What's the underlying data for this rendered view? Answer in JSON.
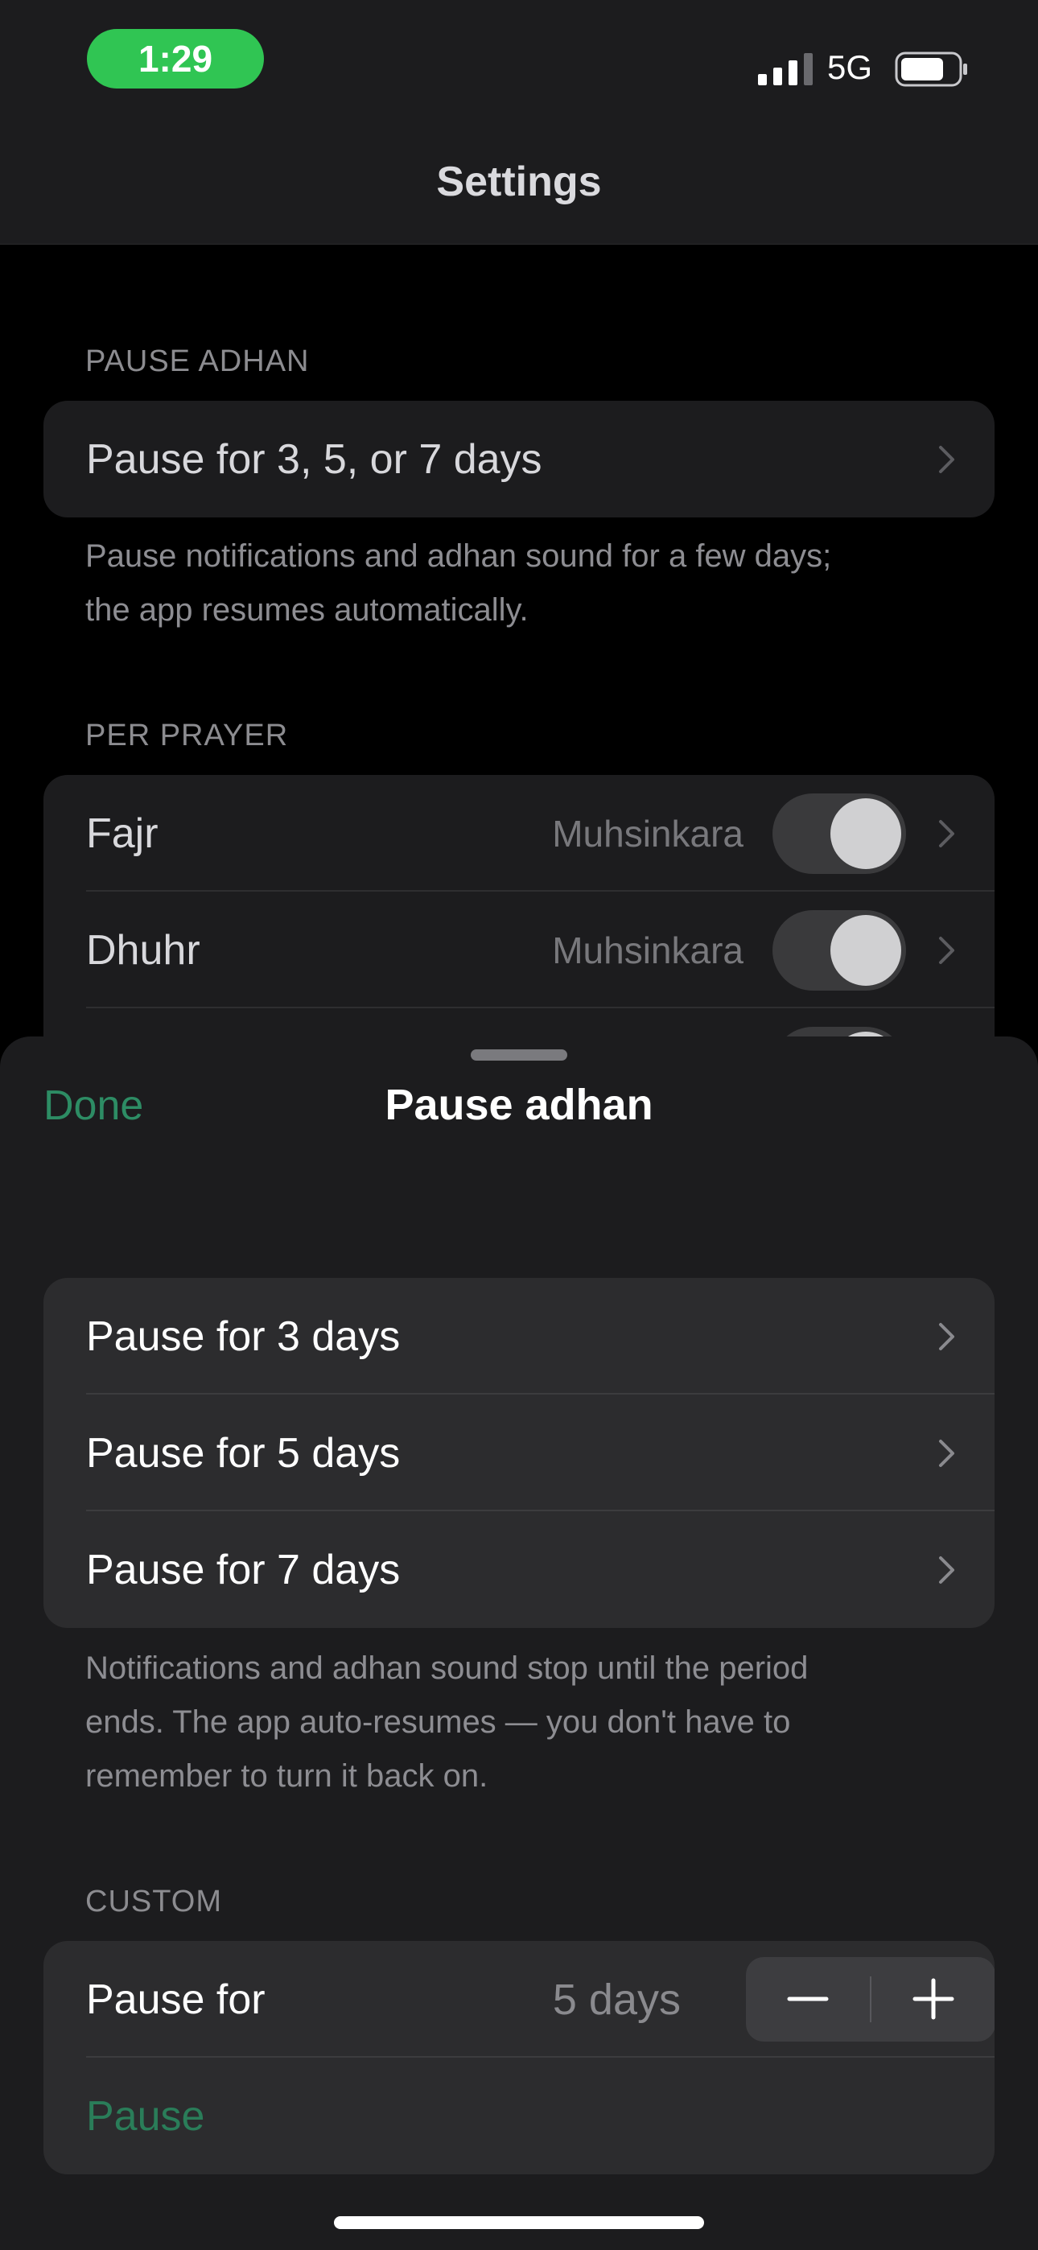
{
  "status_bar": {
    "time": "1:29",
    "network": "5G",
    "signal_icon": "cellular-signal-icon",
    "battery_icon": "battery-icon"
  },
  "nav": {
    "title": "Settings"
  },
  "settings": {
    "pause_adhan": {
      "header": "PAUSE ADHAN",
      "row_label": "Pause for 3, 5, or 7 days",
      "footer_line1": "Pause notifications and adhan sound for a few days;",
      "footer_line2": "the app resumes automatically."
    },
    "per_prayer": {
      "header": "PER PRAYER",
      "rows": [
        {
          "label": "Fajr",
          "value": "Muhsinkara",
          "enabled": true
        },
        {
          "label": "Dhuhr",
          "value": "Muhsinkara",
          "enabled": true
        }
      ]
    }
  },
  "sheet": {
    "done_label": "Done",
    "title": "Pause adhan",
    "options": [
      {
        "label": "Pause for 3 days"
      },
      {
        "label": "Pause for 5 days"
      },
      {
        "label": "Pause for 7 days"
      }
    ],
    "footer_line1": "Notifications and adhan sound stop until the period",
    "footer_line2": "ends. The app auto-resumes — you don't have to",
    "footer_line3": "remember to turn it back on.",
    "custom": {
      "header": "CUSTOM",
      "row_label": "Pause for",
      "value": "5 days",
      "minus_icon": "minus-icon",
      "plus_icon": "plus-icon",
      "action_label": "Pause"
    }
  },
  "colors": {
    "accent_green": "#2d8c64",
    "time_pill": "#30c553"
  }
}
